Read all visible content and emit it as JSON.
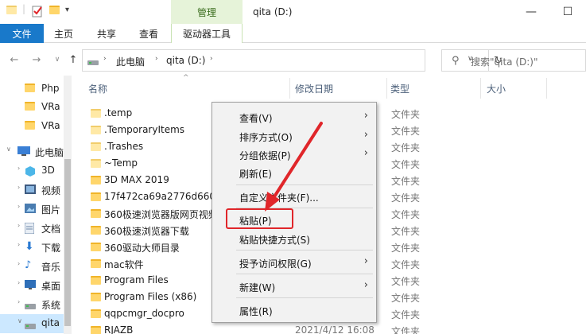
{
  "window": {
    "title": "qita (D:)",
    "contextual_group": "管理",
    "minimize_icon": "minimize-icon",
    "maximize_icon": "maximize-icon"
  },
  "ribbon": {
    "tabs": [
      "文件",
      "主页",
      "共享",
      "查看",
      "驱动器工具"
    ],
    "file_color": "#1979ca"
  },
  "address": {
    "breadcrumb": [
      "此电脑",
      "qita (D:)"
    ],
    "search_placeholder": "搜索\"qita (D:)\""
  },
  "nav": {
    "items": [
      "Php",
      "VRa",
      "VRa",
      "此电脑",
      "3D",
      "视频",
      "图片",
      "文档",
      "下载",
      "音乐",
      "桌面",
      "系统",
      "qita"
    ]
  },
  "columns": {
    "name": "名称",
    "date": "修改日期",
    "type": "类型",
    "size": "大小"
  },
  "files": [
    {
      "name": ".temp",
      "type": "文件夹"
    },
    {
      "name": ".TemporaryItems",
      "type": "文件夹"
    },
    {
      "name": ".Trashes",
      "type": "文件夹"
    },
    {
      "name": "~Temp",
      "type": "文件夹"
    },
    {
      "name": "3D MAX 2019",
      "type": "文件夹"
    },
    {
      "name": "17f472ca69a2776d6609",
      "type": "文件夹"
    },
    {
      "name": "360极速浏览器版网页视频",
      "type": "文件夹"
    },
    {
      "name": "360极速浏览器下载",
      "type": "文件夹"
    },
    {
      "name": "360驱动大师目录",
      "type": "文件夹"
    },
    {
      "name": "mac软件",
      "type": "文件夹"
    },
    {
      "name": "Program Files",
      "type": "文件夹"
    },
    {
      "name": "Program Files (x86)",
      "type": "文件夹"
    },
    {
      "name": "qqpcmgr_docpro",
      "type": "文件夹"
    },
    {
      "name": "RJAZB",
      "date": "2021/4/12 16:08",
      "type": "文件夹"
    }
  ],
  "context_menu": [
    {
      "label": "查看(V)",
      "submenu": true
    },
    {
      "label": "排序方式(O)",
      "submenu": true
    },
    {
      "label": "分组依据(P)",
      "submenu": true
    },
    {
      "label": "刷新(E)",
      "submenu": false
    },
    {
      "label": "自定义文件夹(F)...",
      "submenu": false
    },
    {
      "label": "粘贴(P)",
      "submenu": false
    },
    {
      "label": "粘贴快捷方式(S)",
      "submenu": false
    },
    {
      "label": "授予访问权限(G)",
      "submenu": true
    },
    {
      "label": "新建(W)",
      "submenu": true
    },
    {
      "label": "属性(R)",
      "submenu": false
    }
  ],
  "annotation_color": "#e0262a"
}
